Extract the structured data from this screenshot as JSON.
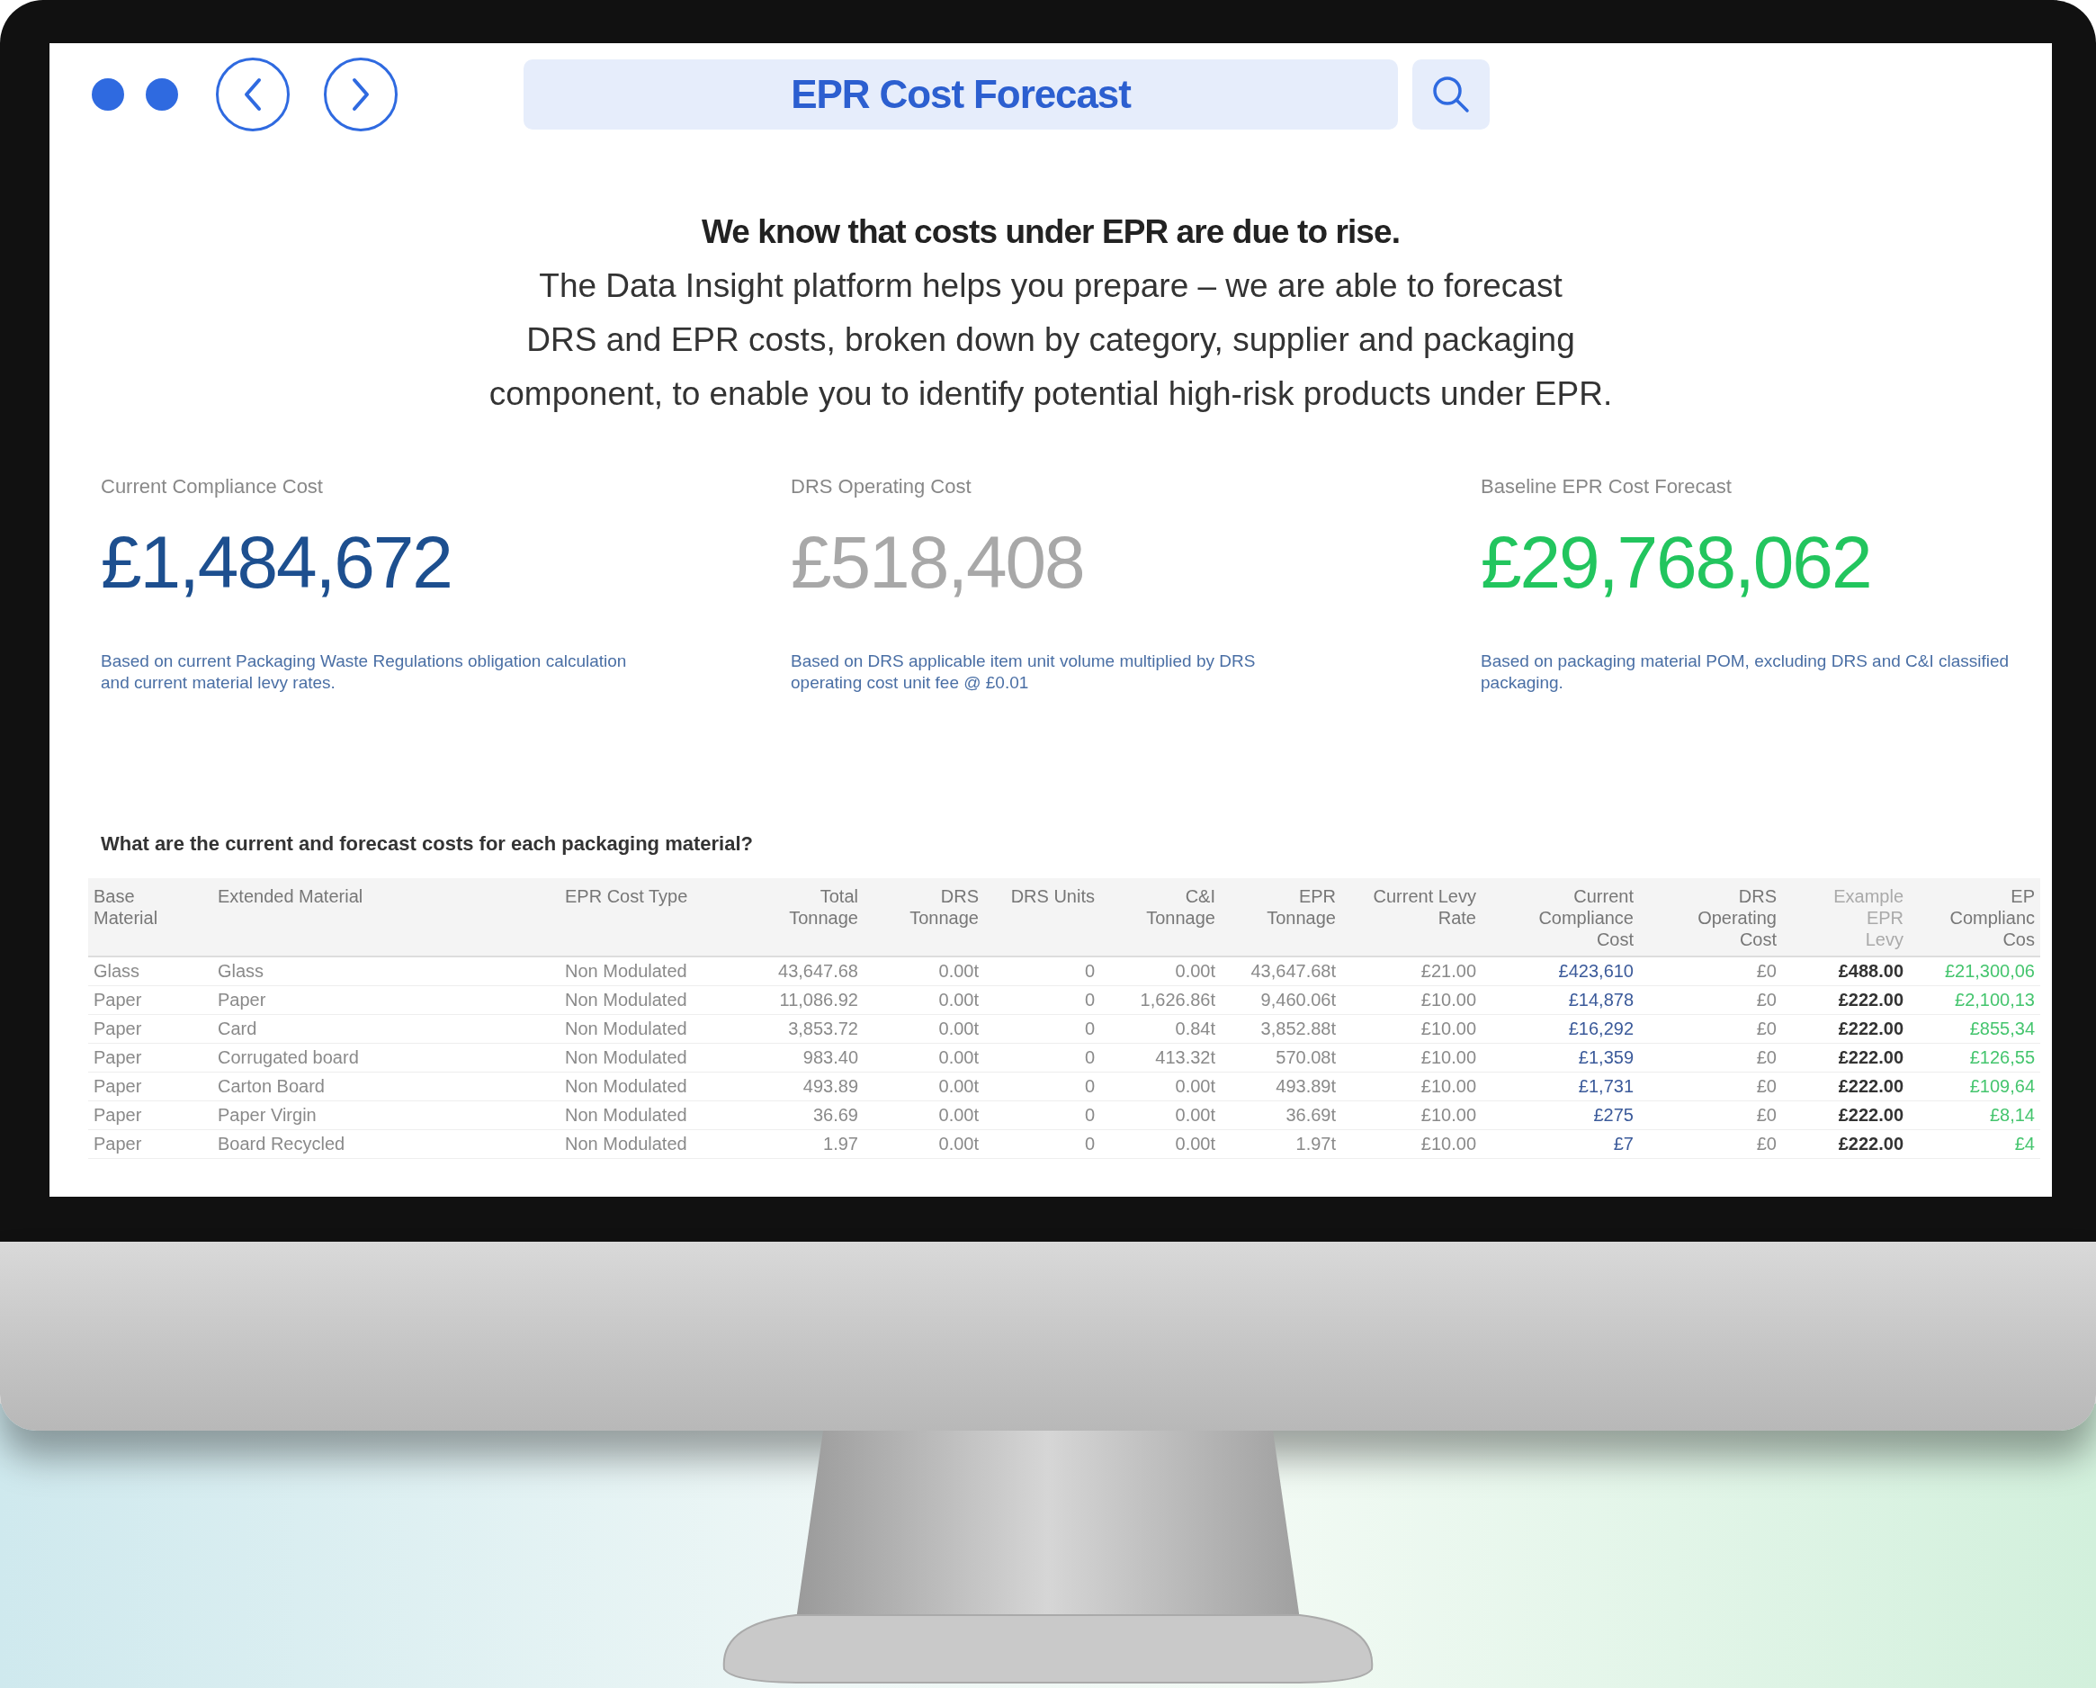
{
  "top_bar": {
    "title": "EPR Cost Forecast"
  },
  "intro": {
    "headline": "We know that costs under EPR are due to rise.",
    "lines": [
      "The Data Insight platform helps you prepare – we are able to forecast",
      "DRS and EPR costs, broken down by category, supplier and packaging",
      "component, to enable you to identify potential high-risk products under EPR."
    ]
  },
  "kpis": [
    {
      "label": "Current Compliance Cost",
      "value": "£1,484,672",
      "color": "#1d4f8f",
      "description": "Based on current Packaging Waste Regulations obligation calculation and current material levy rates."
    },
    {
      "label": "DRS Operating Cost",
      "value": "£518,408",
      "color": "#a8a8a8",
      "description": "Based on DRS applicable item unit volume multiplied by DRS operating cost unit fee @ £0.01"
    },
    {
      "label": "Baseline EPR Cost Forecast",
      "value": "£29,768,062",
      "color": "#22c55e",
      "description": "Based on packaging material POM, excluding DRS and C&I classified packaging."
    }
  ],
  "table": {
    "question": "What are the current and forecast costs for each packaging material?",
    "columns": [
      {
        "header": [
          "Base",
          "Material"
        ],
        "kind": "text"
      },
      {
        "header": [
          "Extended Material"
        ],
        "kind": "text"
      },
      {
        "header": [
          "EPR Cost Type"
        ],
        "kind": "text"
      },
      {
        "header": [
          "Total",
          "Tonnage"
        ],
        "kind": "number"
      },
      {
        "header": [
          "DRS",
          "Tonnage"
        ],
        "kind": "number"
      },
      {
        "header": [
          "DRS Units"
        ],
        "kind": "number"
      },
      {
        "header": [
          "C&I",
          "Tonnage"
        ],
        "kind": "number"
      },
      {
        "header": [
          "EPR",
          "Tonnage"
        ],
        "kind": "number"
      },
      {
        "header": [
          "Current Levy",
          "Rate"
        ],
        "kind": "number"
      },
      {
        "header": [
          "Current",
          "Compliance",
          "Cost"
        ],
        "kind": "cost"
      },
      {
        "header": [
          "DRS",
          "Operating",
          "Cost"
        ],
        "kind": "number"
      },
      {
        "header": [
          "Example",
          "EPR",
          "Levy"
        ],
        "kind": "levy"
      },
      {
        "header": [
          "EP",
          "Complianc",
          "Cos"
        ],
        "kind": "forecast"
      }
    ],
    "rows": [
      [
        "Glass",
        "Glass",
        "Non Modulated",
        "43,647.68",
        "0.00t",
        "0",
        "0.00t",
        "43,647.68t",
        "£21.00",
        "£423,610",
        "£0",
        "£488.00",
        "£21,300,06"
      ],
      [
        "Paper",
        "Paper",
        "Non Modulated",
        "11,086.92",
        "0.00t",
        "0",
        "1,626.86t",
        "9,460.06t",
        "£10.00",
        "£14,878",
        "£0",
        "£222.00",
        "£2,100,13"
      ],
      [
        "Paper",
        "Card",
        "Non Modulated",
        "3,853.72",
        "0.00t",
        "0",
        "0.84t",
        "3,852.88t",
        "£10.00",
        "£16,292",
        "£0",
        "£222.00",
        "£855,34"
      ],
      [
        "Paper",
        "Corrugated board",
        "Non Modulated",
        "983.40",
        "0.00t",
        "0",
        "413.32t",
        "570.08t",
        "£10.00",
        "£1,359",
        "£0",
        "£222.00",
        "£126,55"
      ],
      [
        "Paper",
        "Carton Board",
        "Non Modulated",
        "493.89",
        "0.00t",
        "0",
        "0.00t",
        "493.89t",
        "£10.00",
        "£1,731",
        "£0",
        "£222.00",
        "£109,64"
      ],
      [
        "Paper",
        "Paper Virgin",
        "Non Modulated",
        "36.69",
        "0.00t",
        "0",
        "0.00t",
        "36.69t",
        "£10.00",
        "£275",
        "£0",
        "£222.00",
        "£8,14"
      ],
      [
        "Paper",
        "Board Recycled",
        "Non Modulated",
        "1.97",
        "0.00t",
        "0",
        "0.00t",
        "1.97t",
        "£10.00",
        "£7",
        "£0",
        "£222.00",
        "£4"
      ]
    ]
  }
}
